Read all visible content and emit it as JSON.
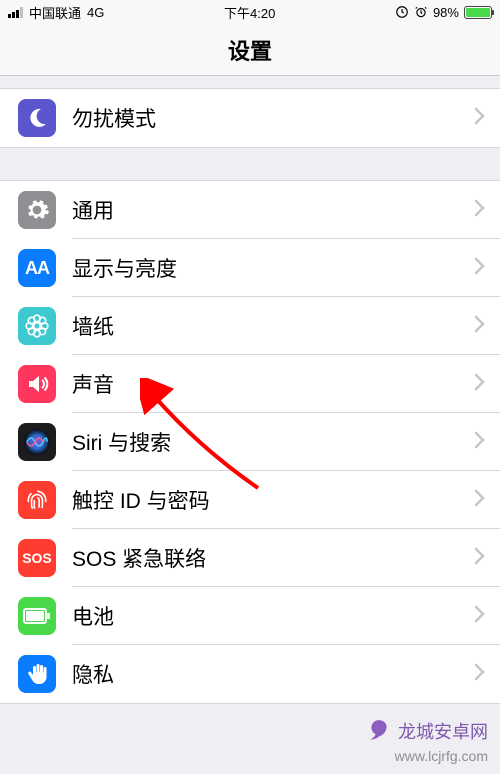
{
  "status": {
    "carrier": "中国联通",
    "network": "4G",
    "time": "下午4:20",
    "battery_pct": "98%",
    "battery_fill": "98%"
  },
  "nav": {
    "title": "设置"
  },
  "groups": [
    {
      "rows": [
        {
          "id": "dnd",
          "label": "勿扰模式",
          "icon": "moon",
          "bg": "#5b56ce",
          "fg": "#ffffff"
        }
      ]
    },
    {
      "rows": [
        {
          "id": "general",
          "label": "通用",
          "icon": "gear",
          "bg": "#8e8e93",
          "fg": "#ffffff"
        },
        {
          "id": "display",
          "label": "显示与亮度",
          "icon": "textsize",
          "bg": "#0a7cff",
          "fg": "#ffffff"
        },
        {
          "id": "wallpaper",
          "label": "墙纸",
          "icon": "flower",
          "bg": "#3ec8cf",
          "fg": "#ffffff"
        },
        {
          "id": "sound",
          "label": "声音",
          "icon": "speaker",
          "bg": "#ff375f",
          "fg": "#ffffff"
        },
        {
          "id": "siri",
          "label": "Siri 与搜索",
          "icon": "siri",
          "bg": "#1c1c1e",
          "fg": "#ffffff"
        },
        {
          "id": "touchid",
          "label": "触控 ID 与密码",
          "icon": "fingerprint",
          "bg": "#ff3c30",
          "fg": "#ffffff"
        },
        {
          "id": "sos",
          "label": "SOS 紧急联络",
          "icon": "sos",
          "bg": "#ff3c30",
          "fg": "#ffffff",
          "icon_text": "SOS"
        },
        {
          "id": "battery",
          "label": "电池",
          "icon": "battery",
          "bg": "#49d84a",
          "fg": "#ffffff"
        },
        {
          "id": "privacy",
          "label": "隐私",
          "icon": "hand",
          "bg": "#0a7cff",
          "fg": "#ffffff"
        }
      ]
    }
  ],
  "watermark": {
    "name": "龙城安卓网",
    "url": "www.lcjrfg.com"
  }
}
